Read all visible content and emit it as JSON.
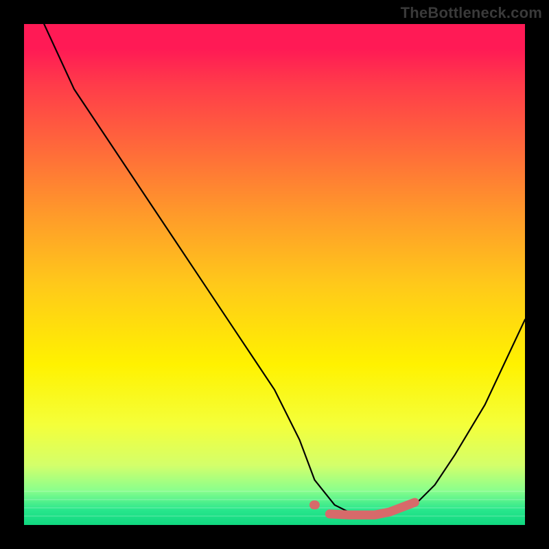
{
  "watermark": "TheBottleneck.com",
  "chart_data": {
    "type": "line",
    "title": "",
    "xlabel": "",
    "ylabel": "",
    "xlim": [
      0,
      100
    ],
    "ylim": [
      0,
      100
    ],
    "series": [
      {
        "name": "bottleneck-curve",
        "x": [
          4,
          10,
          18,
          26,
          34,
          42,
          50,
          55,
          58,
          62,
          66,
          70,
          74,
          78,
          82,
          86,
          92,
          100
        ],
        "values": [
          100,
          87,
          75,
          63,
          51,
          39,
          27,
          17,
          9,
          4,
          2,
          2,
          3,
          4,
          8,
          14,
          24,
          41
        ]
      }
    ],
    "annotations": [
      {
        "name": "optimal-range-marker",
        "x_start": 58,
        "x_end": 78,
        "y": 2
      }
    ],
    "gradient_stops": [
      {
        "pos": 0,
        "color": "#ff1a55"
      },
      {
        "pos": 25,
        "color": "#ff6a3a"
      },
      {
        "pos": 52,
        "color": "#ffc91a"
      },
      {
        "pos": 68,
        "color": "#fff200"
      },
      {
        "pos": 93,
        "color": "#8cff8c"
      },
      {
        "pos": 100,
        "color": "#10d880"
      }
    ]
  }
}
